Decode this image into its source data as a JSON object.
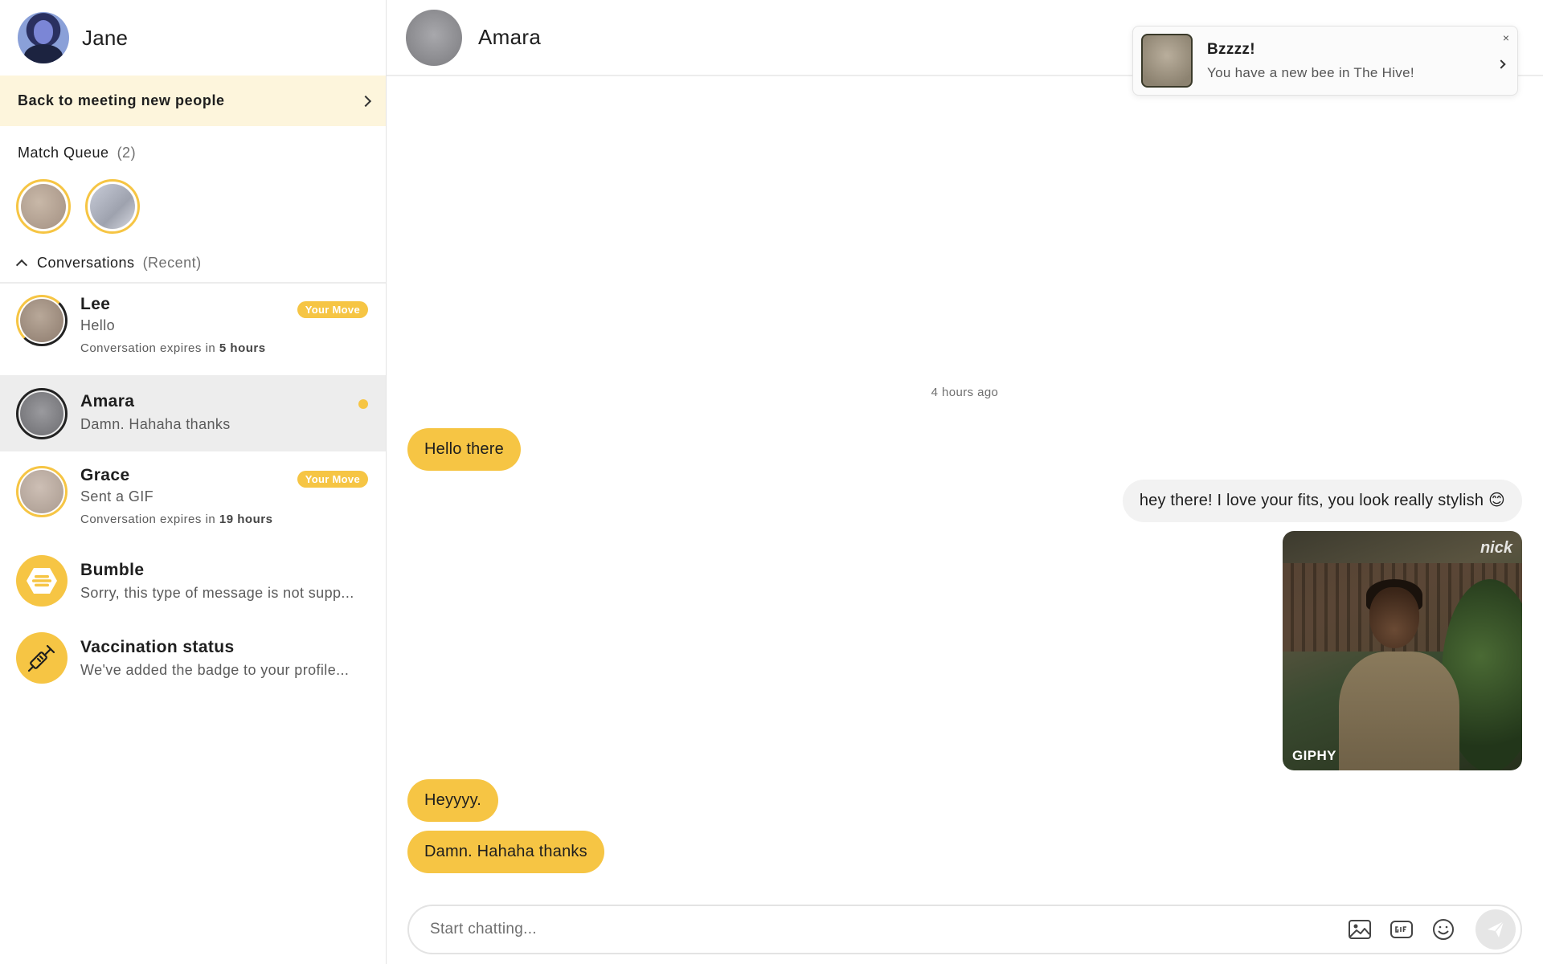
{
  "user": {
    "name": "Jane"
  },
  "sidebar": {
    "back_label": "Back to meeting new people",
    "match_queue": {
      "title": "Match Queue",
      "count": "(2)"
    },
    "conversations": {
      "title": "Conversations",
      "qualifier": "(Recent)",
      "items": [
        {
          "name": "Lee",
          "message": "Hello",
          "expires_prefix": "Conversation expires in",
          "expires_value": "5 hours",
          "badge": "Your Move"
        },
        {
          "name": "Amara",
          "message": "Damn. Hahaha thanks"
        },
        {
          "name": "Grace",
          "message": "Sent a GIF",
          "expires_prefix": "Conversation expires in",
          "expires_value": "19 hours",
          "badge": "Your Move"
        },
        {
          "name": "Bumble",
          "message": "Sorry, this type of message is not supp..."
        },
        {
          "name": "Vaccination status",
          "message": "We've added the badge to your profile..."
        }
      ]
    }
  },
  "chat": {
    "contact_name": "Amara",
    "timestamp": "4 hours ago",
    "messages": [
      {
        "direction": "in",
        "text": "Hello there"
      },
      {
        "direction": "out",
        "text": "hey there! I love your fits, you look really stylish 😊"
      },
      {
        "direction": "out",
        "type": "gif",
        "brand": "nick",
        "source": "GIPHY"
      },
      {
        "direction": "in",
        "text": "Heyyyy."
      },
      {
        "direction": "in",
        "text": "Damn. Hahaha thanks"
      }
    ],
    "composer": {
      "placeholder": "Start chatting..."
    }
  },
  "toast": {
    "title": "Bzzzz!",
    "body": "You have a new bee in The Hive!",
    "close": "×"
  },
  "colors": {
    "accent": "#f6c544",
    "banner": "#fdf5dc",
    "active_row": "#ededed",
    "outgoing_bubble": "#f2f2f2"
  }
}
